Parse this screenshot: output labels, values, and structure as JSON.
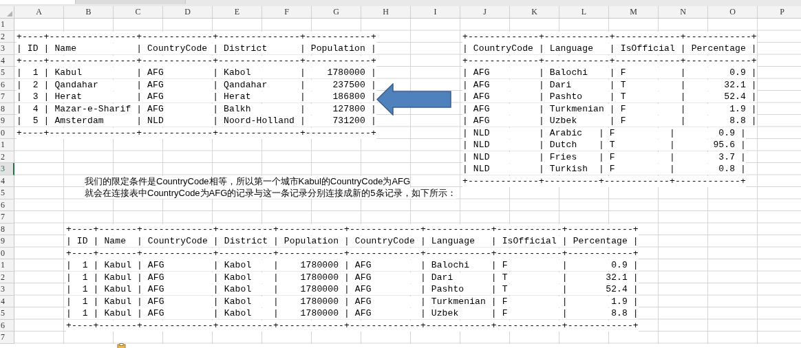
{
  "sheet": {
    "columns": [
      "A",
      "B",
      "C",
      "D",
      "E",
      "F",
      "G",
      "H",
      "I",
      "J",
      "K",
      "L",
      "M",
      "N",
      "O",
      "P"
    ],
    "rows": [
      {
        "number": "1",
        "selected": false
      },
      {
        "number": "2",
        "selected": false,
        "cells": [
          {
            "kind": "city_table",
            "text": "+----+----------------+-------------+---------------+------------+"
          },
          {
            "kind": "language_table",
            "text": "+-------------+------------+------------+------------+"
          }
        ]
      },
      {
        "number": "3",
        "selected": false,
        "cells": [
          {
            "kind": "city_table",
            "text": "| ID | Name           | CountryCode | District      | Population |"
          },
          {
            "kind": "language_table",
            "text": "| CountryCode | Language   | IsOfficial | Percentage |"
          }
        ]
      },
      {
        "number": "4",
        "selected": false,
        "cells": [
          {
            "kind": "city_table",
            "text": "+----+----------------+-------------+---------------+------------+"
          },
          {
            "kind": "language_table",
            "text": "+-------------+------------+------------+------------+"
          }
        ]
      },
      {
        "number": "5",
        "selected": false,
        "cells": [
          {
            "kind": "city_table",
            "text": "|  1 | Kabul          | AFG         | Kabol         |    1780000 |"
          },
          {
            "kind": "language_table",
            "text": "| AFG         | Balochi    | F          |        0.9 |"
          }
        ]
      },
      {
        "number": "6",
        "selected": false,
        "cells": [
          {
            "kind": "city_table",
            "text": "|  2 | Qandahar       | AFG         | Qandahar      |     237500 |"
          },
          {
            "kind": "language_table",
            "text": "| AFG         | Dari       | T          |       32.1 |"
          }
        ]
      },
      {
        "number": "7",
        "selected": false,
        "cells": [
          {
            "kind": "city_table",
            "text": "|  3 | Herat          | AFG         | Herat         |     186800 |"
          },
          {
            "kind": "language_table",
            "text": "| AFG         | Pashto     | T          |       52.4 |"
          }
        ]
      },
      {
        "number": "8",
        "selected": false,
        "cells": [
          {
            "kind": "city_table",
            "text": "|  4 | Mazar-e-Sharif | AFG         | Balkh         |     127800 |"
          },
          {
            "kind": "language_table",
            "text": "| AFG         | Turkmenian | F          |        1.9 |"
          }
        ]
      },
      {
        "number": "9",
        "selected": false,
        "cells": [
          {
            "kind": "city_table",
            "text": "|  5 | Amsterdam      | NLD         | Noord-Holland |     731200 |"
          },
          {
            "kind": "language_table",
            "text": "| AFG         | Uzbek      | F          |        8.8 |"
          }
        ]
      },
      {
        "number": "0",
        "selected": false,
        "cells": [
          {
            "kind": "city_table",
            "text": "+----+----------------+-------------+---------------+------------+"
          },
          {
            "kind": "language_table",
            "text": "| NLD         | Arabic   | F          |        0.9 |"
          }
        ]
      },
      {
        "number": "1",
        "selected": false,
        "cells": [
          {
            "kind": "language_table",
            "text": "| NLD         | Dutch    | T          |       95.6 |"
          }
        ]
      },
      {
        "number": "2",
        "selected": false,
        "cells": [
          {
            "kind": "language_table",
            "text": "| NLD         | Fries    | F          |        3.7 |"
          }
        ]
      },
      {
        "number": "3",
        "selected": true,
        "cells": [
          {
            "kind": "language_table",
            "text": "| NLD         | Turkish  | F          |        0.8 |"
          }
        ]
      },
      {
        "number": "4",
        "selected": false,
        "cells": [
          {
            "kind": "note",
            "text": "我们的限定条件是CountryCode相等，所以第一个城市Kabul的CountryCode为AFG"
          },
          {
            "kind": "language_table",
            "text": "+-------------+----------+------------+------------+"
          }
        ]
      },
      {
        "number": "5",
        "selected": false,
        "cells": [
          {
            "kind": "note",
            "text": "就会在连接表中CountryCode为AFG的记录与这一条记录分别连接成新的5条记录，如下所示："
          }
        ]
      },
      {
        "number": "6",
        "selected": false
      },
      {
        "number": "7",
        "selected": false
      },
      {
        "number": "8",
        "selected": false,
        "cells": [
          {
            "kind": "joined_table",
            "text": "+----+-------+-------------+----------+------------+-------------+------------+------------+------------+"
          }
        ]
      },
      {
        "number": "9",
        "selected": false,
        "cells": [
          {
            "kind": "joined_table",
            "text": "| ID | Name  | CountryCode | District | Population | CountryCode | Language   | IsOfficial | Percentage |"
          }
        ]
      },
      {
        "number": "0",
        "selected": false,
        "cells": [
          {
            "kind": "joined_table",
            "text": "+----+-------+-------------+----------+------------+-------------+------------+------------+------------+"
          }
        ]
      },
      {
        "number": "1",
        "selected": false,
        "cells": [
          {
            "kind": "joined_table",
            "text": "|  1 | Kabul | AFG         | Kabol    |    1780000 | AFG         | Balochi    | F          |        0.9 |"
          }
        ]
      },
      {
        "number": "2",
        "selected": false,
        "cells": [
          {
            "kind": "joined_table",
            "text": "|  1 | Kabul | AFG         | Kabol    |    1780000 | AFG         | Dari       | T          |       32.1 |"
          }
        ]
      },
      {
        "number": "3",
        "selected": false,
        "cells": [
          {
            "kind": "joined_table",
            "text": "|  1 | Kabul | AFG         | Kabol    |    1780000 | AFG         | Pashto     | T          |       52.4 |"
          }
        ]
      },
      {
        "number": "4",
        "selected": false,
        "cells": [
          {
            "kind": "joined_table",
            "text": "|  1 | Kabul | AFG         | Kabol    |    1780000 | AFG         | Turkmenian | F          |        1.9 |"
          }
        ]
      },
      {
        "number": "5",
        "selected": false,
        "cells": [
          {
            "kind": "joined_table",
            "text": "|  1 | Kabul | AFG         | Kabol    |    1780000 | AFG         | Uzbek      | F          |        8.8 |"
          }
        ]
      },
      {
        "number": "6",
        "selected": false,
        "cells": [
          {
            "kind": "joined_table",
            "text": "+----+-------+-------------+----------+------------+-------------+------------+------------+------------+"
          }
        ]
      },
      {
        "number": "7",
        "selected": false
      }
    ]
  }
}
